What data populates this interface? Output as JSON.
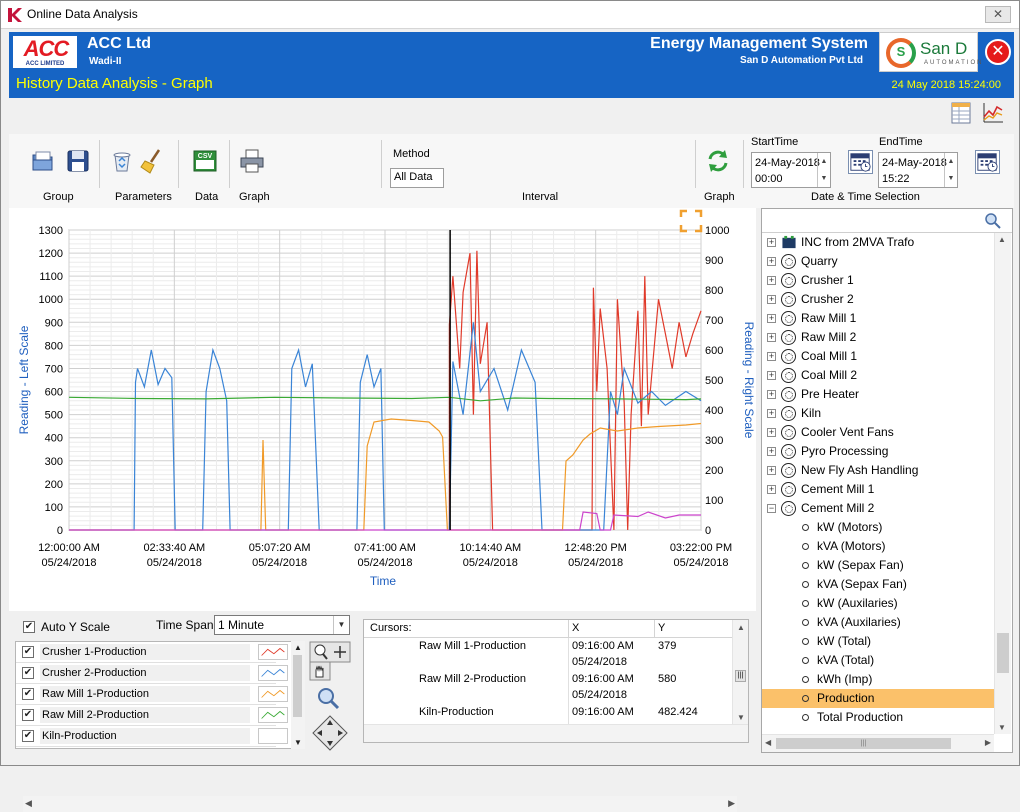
{
  "window": {
    "title": "Online Data Analysis",
    "close_glyph": "✕"
  },
  "header": {
    "logo_text": "ACC",
    "logo_subtext": "ACC LIMITED",
    "company": "ACC Ltd",
    "plant": "Wadi-II",
    "system": "Energy Management System",
    "vendor": "San D Automation Pvt Ltd",
    "vendor_logo_text": "San D",
    "vendor_logo_sub": "AUTOMATION"
  },
  "subbar": {
    "title": "History Data Analysis - Graph",
    "datetime": "24 May 2018 15:24:00"
  },
  "toolbar": {
    "groups": [
      "Group",
      "Parameters",
      "Data",
      "Graph",
      "Interval",
      "Graph",
      "Date & Time Selection"
    ],
    "method_label": "Method",
    "method_value": "All Data",
    "csv_label": "CSV",
    "start_label": "StartTime",
    "start_date": "24-May-2018",
    "start_time": "00:00",
    "end_label": "EndTime",
    "end_date": "24-May-2018",
    "end_time": "15:22"
  },
  "chart_data": {
    "type": "line",
    "xlabel": "Time",
    "ylabel_left": "Reading - Left Scale",
    "ylabel_right": "Reading - Right Scale",
    "ylim_left": [
      0,
      1300
    ],
    "ylim_right": [
      0,
      1000
    ],
    "yticks_left": [
      "0",
      "100",
      "200",
      "300",
      "400",
      "500",
      "600",
      "700",
      "800",
      "900",
      "1000",
      "1100",
      "1200",
      "1300"
    ],
    "yticks_right": [
      "0",
      "100",
      "200",
      "300",
      "400",
      "500",
      "600",
      "700",
      "800",
      "900",
      "1000"
    ],
    "xticks": [
      {
        "time": "12:00:00 AM",
        "date": "05/24/2018"
      },
      {
        "time": "02:33:40 AM",
        "date": "05/24/2018"
      },
      {
        "time": "05:07:20 AM",
        "date": "05/24/2018"
      },
      {
        "time": "07:41:00 AM",
        "date": "05/24/2018"
      },
      {
        "time": "10:14:40 AM",
        "date": "05/24/2018"
      },
      {
        "time": "12:48:20 PM",
        "date": "05/24/2018"
      },
      {
        "time": "03:22:00 PM",
        "date": "05/24/2018"
      }
    ],
    "x_minutes": [
      0,
      922
    ],
    "cursor_at": "09:16:00 AM",
    "grid": true,
    "series": [
      {
        "name": "Crusher 1-Production",
        "color": "#e03a2a",
        "axis": "left",
        "segments": [
          [
            555,
            0
          ],
          [
            555,
            890
          ],
          [
            560,
            1100
          ],
          [
            570,
            700
          ],
          [
            575,
            1030
          ],
          [
            585,
            1200
          ],
          [
            590,
            500
          ],
          [
            595,
            1210
          ],
          [
            600,
            720
          ],
          [
            610,
            900
          ],
          [
            618,
            0
          ],
          [
            620,
            0
          ],
          [
            763,
            0
          ],
          [
            765,
            1050
          ],
          [
            770,
            600
          ],
          [
            775,
            960
          ],
          [
            785,
            700
          ],
          [
            795,
            0
          ],
          [
            800,
            1000
          ],
          [
            810,
            550
          ],
          [
            815,
            0
          ],
          [
            820,
            500
          ],
          [
            830,
            950
          ],
          [
            835,
            450
          ],
          [
            840,
            1100
          ],
          [
            845,
            500
          ],
          [
            860,
            1000
          ],
          [
            870,
            850
          ],
          [
            880,
            700
          ],
          [
            890,
            900
          ],
          [
            900,
            750
          ],
          [
            910,
            850
          ],
          [
            922,
            950
          ]
        ]
      },
      {
        "name": "Crusher 2-Production",
        "color": "#3a84d6",
        "axis": "left",
        "segments": [
          [
            0,
            0
          ],
          [
            95,
            0
          ],
          [
            97,
            640
          ],
          [
            100,
            700
          ],
          [
            110,
            620
          ],
          [
            120,
            780
          ],
          [
            130,
            630
          ],
          [
            140,
            700
          ],
          [
            150,
            660
          ],
          [
            155,
            0
          ],
          [
            160,
            0
          ],
          [
            195,
            0
          ],
          [
            200,
            600
          ],
          [
            210,
            780
          ],
          [
            220,
            700
          ],
          [
            230,
            560
          ],
          [
            235,
            0
          ],
          [
            320,
            0
          ],
          [
            325,
            700
          ],
          [
            335,
            780
          ],
          [
            345,
            620
          ],
          [
            355,
            720
          ],
          [
            365,
            0
          ],
          [
            420,
            0
          ],
          [
            425,
            640
          ],
          [
            435,
            760
          ],
          [
            445,
            620
          ],
          [
            455,
            700
          ],
          [
            460,
            0
          ],
          [
            555,
            0
          ],
          [
            560,
            730
          ],
          [
            575,
            500
          ],
          [
            590,
            900
          ],
          [
            600,
            600
          ],
          [
            620,
            700
          ],
          [
            640,
            520
          ],
          [
            660,
            780
          ],
          [
            680,
            640
          ],
          [
            690,
            0
          ],
          [
            780,
            0
          ],
          [
            790,
            600
          ],
          [
            800,
            500
          ],
          [
            810,
            700
          ],
          [
            830,
            550
          ],
          [
            850,
            600
          ],
          [
            870,
            540
          ],
          [
            900,
            600
          ],
          [
            922,
            560
          ]
        ]
      },
      {
        "name": "Raw Mill 1-Production",
        "color": "#f09a28",
        "axis": "right",
        "segments": [
          [
            0,
            0
          ],
          [
            280,
            0
          ],
          [
            283,
            300
          ],
          [
            287,
            0
          ],
          [
            430,
            0
          ],
          [
            435,
            280
          ],
          [
            445,
            360
          ],
          [
            470,
            370
          ],
          [
            500,
            365
          ],
          [
            525,
            360
          ],
          [
            540,
            330
          ],
          [
            545,
            310
          ],
          [
            552,
            0
          ],
          [
            720,
            0
          ],
          [
            725,
            230
          ],
          [
            735,
            250
          ],
          [
            750,
            300
          ],
          [
            760,
            320
          ],
          [
            775,
            340
          ],
          [
            800,
            330
          ],
          [
            830,
            340
          ],
          [
            860,
            345
          ],
          [
            900,
            350
          ],
          [
            922,
            355
          ]
        ]
      },
      {
        "name": "Raw Mill 2-Production",
        "color": "#3aaa35",
        "axis": "left",
        "segments": [
          [
            0,
            575
          ],
          [
            100,
            570
          ],
          [
            200,
            568
          ],
          [
            300,
            575
          ],
          [
            400,
            572
          ],
          [
            500,
            570
          ],
          [
            555,
            575
          ],
          [
            600,
            560
          ],
          [
            650,
            572
          ],
          [
            700,
            570
          ],
          [
            800,
            568
          ],
          [
            900,
            565
          ],
          [
            922,
            568
          ]
        ]
      },
      {
        "name": "Kiln-Production",
        "color": "#cc44cc",
        "axis": "right",
        "segments": [
          [
            0,
            0
          ],
          [
            745,
            0
          ],
          [
            750,
            60
          ],
          [
            770,
            55
          ],
          [
            775,
            0
          ],
          [
            790,
            0
          ],
          [
            795,
            50
          ],
          [
            830,
            45
          ],
          [
            845,
            60
          ],
          [
            870,
            40
          ],
          [
            890,
            50
          ],
          [
            922,
            50
          ]
        ]
      }
    ]
  },
  "controls": {
    "auto_y_label": "Auto Y Scale",
    "timespan_label": "Time Span",
    "timespan_value": "1 Minute",
    "legend": [
      "Crusher 1-Production",
      "Crusher 2-Production",
      "Raw Mill 1-Production",
      "Raw Mill 2-Production",
      "Kiln-Production"
    ]
  },
  "cursors": {
    "header": "Cursors:",
    "col_x": "X",
    "col_y": "Y",
    "rows": [
      {
        "name": "Raw Mill 1-Production",
        "time": "09:16:00 AM",
        "date": "05/24/2018",
        "y": "379"
      },
      {
        "name": "Raw Mill 2-Production",
        "time": "09:16:00 AM",
        "date": "05/24/2018",
        "y": "580"
      },
      {
        "name": "Kiln-Production",
        "time": "09:16:00 AM",
        "date": "",
        "y": "482.424"
      }
    ]
  },
  "tree": {
    "groups": [
      "INC from 2MVA Trafo",
      "Quarry",
      "Crusher 1",
      "Crusher 2",
      "Raw Mill 1",
      "Raw Mill 2",
      "Coal Mill 1",
      "Coal Mill 2",
      "Pre Heater",
      "Kiln",
      "Cooler Vent Fans",
      "Pyro Processing",
      "New Fly Ash Handling",
      "Cement Mill 1",
      "Cement Mill 2"
    ],
    "children": [
      "kW (Motors)",
      "kVA (Motors)",
      "kW (Sepax Fan)",
      "kVA (Sepax Fan)",
      "kW (Auxilaries)",
      "kVA (Auxilaries)",
      "kW (Total)",
      "kVA (Total)",
      "kWh (Imp)",
      "Production",
      "Total Production"
    ],
    "selected": "Production"
  },
  "scroll_glyphs": {
    "up": "▲",
    "down": "▼",
    "left": "◀",
    "right": "▶",
    "grip": "|||"
  },
  "expander_glyphs": {
    "collapsed": "+",
    "expanded": "−"
  }
}
